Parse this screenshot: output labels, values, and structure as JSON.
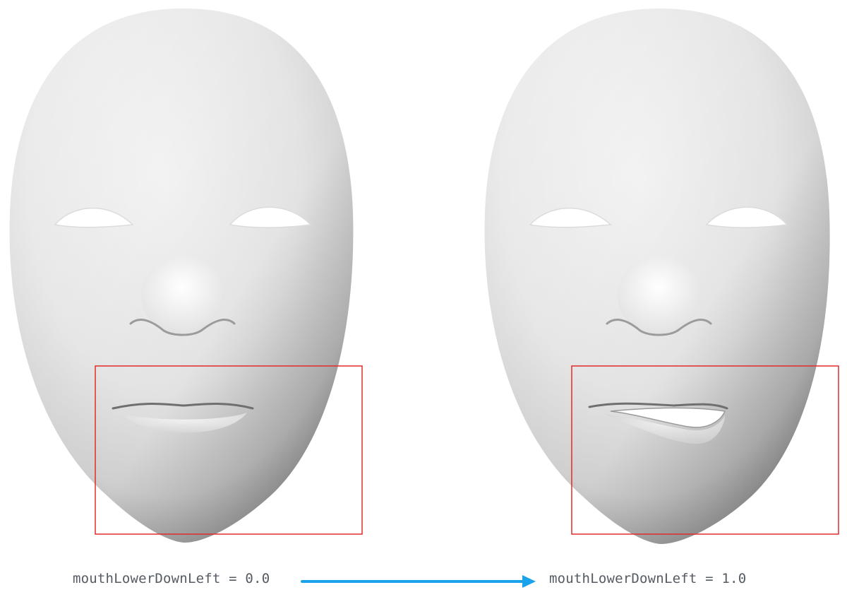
{
  "blendshape": {
    "name": "mouthLowerDownLeft",
    "before_value": "0.0",
    "after_value": "1.0",
    "before_label": "mouthLowerDownLeft = 0.0",
    "after_label": "mouthLowerDownLeft = 1.0"
  },
  "colors": {
    "highlight_box": "#e02b2b",
    "arrow": "#1aa3ec",
    "face_light": "#f4f4f4",
    "face_shadow": "#8d8d8d",
    "caption_text": "#555b63"
  },
  "icons": {
    "arrow": "right-arrow-icon"
  }
}
